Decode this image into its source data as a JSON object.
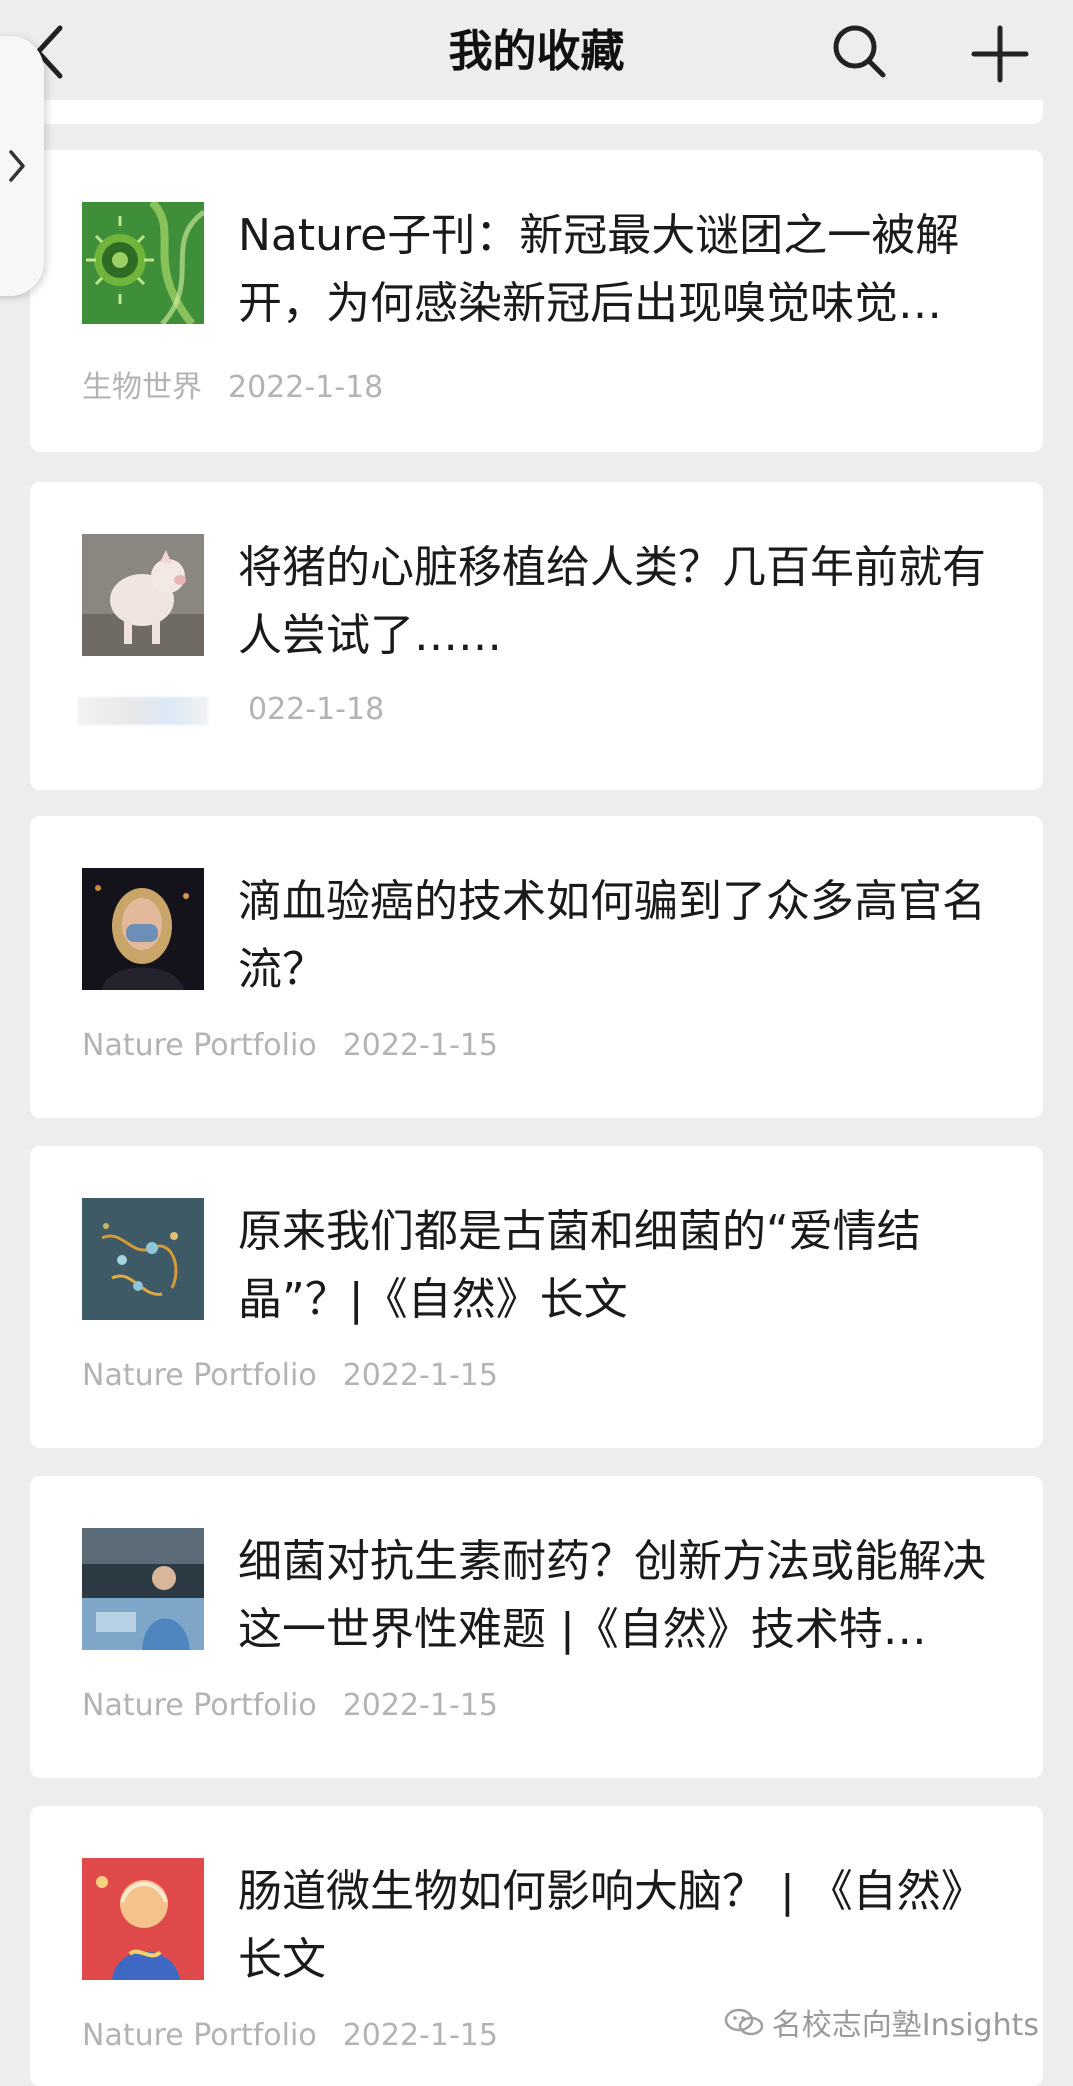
{
  "header": {
    "title": "我的收藏"
  },
  "items": [
    {
      "title": "Nature子刊：新冠最大谜团之一被解开，为何感染新冠后出现嗅觉味觉…",
      "source": "生物世界",
      "date": "2022-1-18"
    },
    {
      "title": "将猪的心脏移植给人类？几百年前就有人尝试了……",
      "source": "",
      "date": "022-1-18"
    },
    {
      "title": "滴血验癌的技术如何骗到了众多高官名流？",
      "source": "Nature Portfolio",
      "date": "2022-1-15"
    },
    {
      "title": "原来我们都是古菌和细菌的“爱情结晶”？|《自然》长文",
      "source": "Nature Portfolio",
      "date": "2022-1-15"
    },
    {
      "title": "细菌对抗生素耐药？创新方法或能解决这一世界性难题 |《自然》技术特…",
      "source": "Nature Portfolio",
      "date": "2022-1-15"
    },
    {
      "title": "肠道微生物如何影响大脑？ | 《自然》长文",
      "source": "Nature Portfolio",
      "date": "2022-1-15"
    }
  ],
  "watermark": {
    "text": "名校志向塾Insights"
  }
}
